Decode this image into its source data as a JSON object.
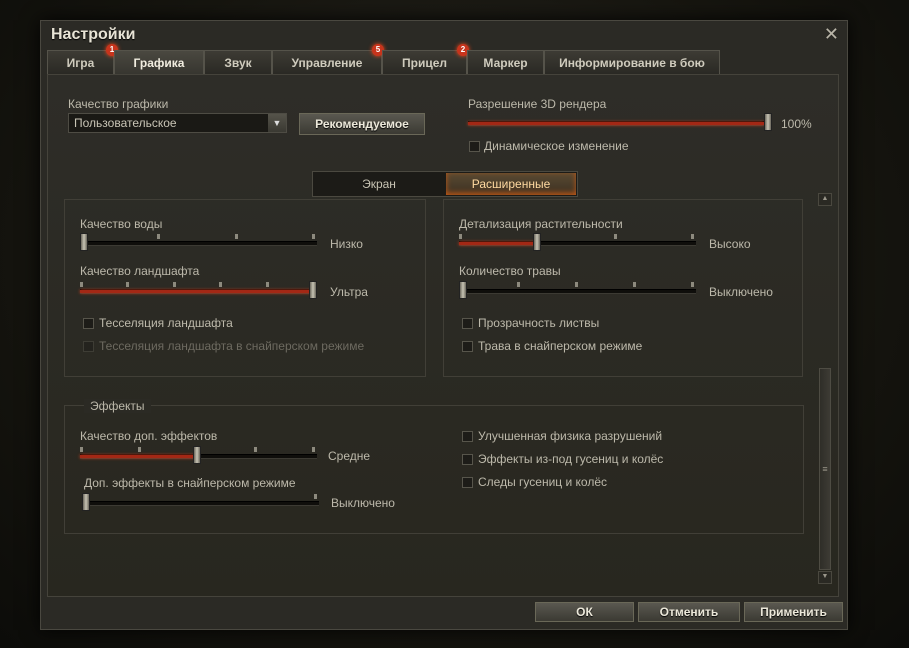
{
  "window": {
    "title": "Настройки"
  },
  "tabs": [
    {
      "label": "Игра",
      "badge": "1"
    },
    {
      "label": "Графика"
    },
    {
      "label": "Звук"
    },
    {
      "label": "Управление",
      "badge": "5"
    },
    {
      "label": "Прицел",
      "badge": "2"
    },
    {
      "label": "Маркер"
    },
    {
      "label": "Информирование в бою"
    }
  ],
  "top": {
    "quality_label": "Качество графики",
    "quality_value": "Пользовательское",
    "recommended_btn": "Рекомендуемое",
    "resolution_label": "Разрешение 3D рендера",
    "resolution_value": "100%",
    "resolution_fraction": 1.0,
    "dynamic_label": "Динамическое изменение"
  },
  "subtabs": {
    "screen": "Экран",
    "advanced": "Расширенные"
  },
  "left_group": {
    "water_label": "Качество воды",
    "water_value": "Низко",
    "landscape_label": "Качество ландшафта",
    "landscape_value": "Ультра",
    "tess_label": "Тесселяция ландшафта",
    "tess_sniper_label": "Тесселяция ландшафта в снайперском режиме"
  },
  "right_group": {
    "veg_label": "Детализация растительности",
    "veg_value": "Высоко",
    "grass_label": "Количество травы",
    "grass_value": "Выключено",
    "leaves_label": "Прозрачность листвы",
    "grass_sniper_label": "Трава в снайперском режиме"
  },
  "effects": {
    "group_title": "Эффекты",
    "quality_label": "Качество доп. эффектов",
    "quality_value": "Средне",
    "sniper_label": "Доп. эффекты в снайперском режиме",
    "sniper_value": "Выключено",
    "physics_label": "Улучшенная физика разрушений",
    "tracks_effects_label": "Эффекты из-под гусениц и колёс",
    "tracks_label": "Следы гусениц и колёс"
  },
  "footer": {
    "ok": "ОК",
    "cancel": "Отменить",
    "apply": "Применить"
  },
  "colors": {
    "accent": "#a32815",
    "badge": "#c8341c"
  }
}
